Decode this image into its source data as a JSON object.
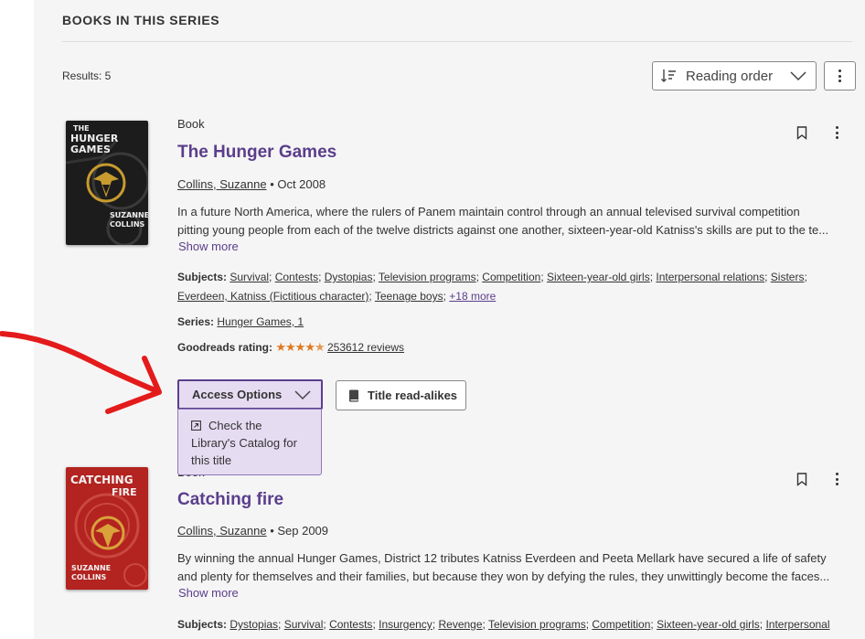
{
  "section": {
    "title": "BOOKS IN THIS SERIES",
    "results": "Results: 5"
  },
  "sort": {
    "label": "Reading order"
  },
  "books": [
    {
      "type": "Book",
      "title": "The Hunger Games",
      "author": "Collins, Suzanne",
      "date": "• Oct 2008",
      "desc_line1": "In a future North America, where the rulers of Panem maintain control through an annual televised survival competition",
      "desc_line2": "pitting young people from each of the twelve districts against one another, sixteen-year-old Katniss's skills are put to the te...",
      "show_more": "Show more",
      "subjects_label": "Subjects:",
      "subjects": [
        "Survival",
        "Contests",
        "Dystopias",
        "Television programs",
        "Competition",
        "Sixteen-year-old girls",
        "Interpersonal relations",
        "Sisters",
        "Everdeen, Katniss (Fictitious character)",
        "Teenage boys"
      ],
      "subjects_more": "+18 more",
      "series_label": "Series:",
      "series": "Hunger Games, 1",
      "rating_label": "Goodreads rating:",
      "rating_value": 4.5,
      "reviews": "253612 reviews",
      "cover": {
        "line1": "THE",
        "line2": "HUNGER",
        "line3": "GAMES",
        "author1": "SUZANNE",
        "author2": "COLLINS",
        "color": "#1c1c1c"
      }
    },
    {
      "type": "Book",
      "title": "Catching fire",
      "author": "Collins, Suzanne",
      "date": "• Sep 2009",
      "desc_line1": "By winning the annual Hunger Games, District 12 tributes Katniss Everdeen and Peeta Mellark have secured a life of safety",
      "desc_line2": "and plenty for themselves and their families, but because they won by defying the rules, they unwittingly become the faces...",
      "show_more": "Show more",
      "subjects_label": "Subjects:",
      "subjects": [
        "Dystopias",
        "Survival",
        "Contests",
        "Insurgency",
        "Revenge",
        "Television programs",
        "Competition",
        "Sixteen-year-old girls",
        "Interpersonal"
      ],
      "cover": {
        "line1": "CATCHING",
        "line2": "FIRE",
        "author1": "SUZANNE",
        "author2": "COLLINS",
        "color": "#b3231f"
      }
    }
  ],
  "access": {
    "label": "Access Options",
    "menu_item": "Check the Library's Catalog for this title"
  },
  "readalikes": {
    "label": "Title read-alikes"
  },
  "annotation": {
    "color": "#e41b1b"
  },
  "colors": {
    "accent": "#5b3e8c",
    "star": "#e07a1f",
    "panel": "#f5f5f5"
  }
}
